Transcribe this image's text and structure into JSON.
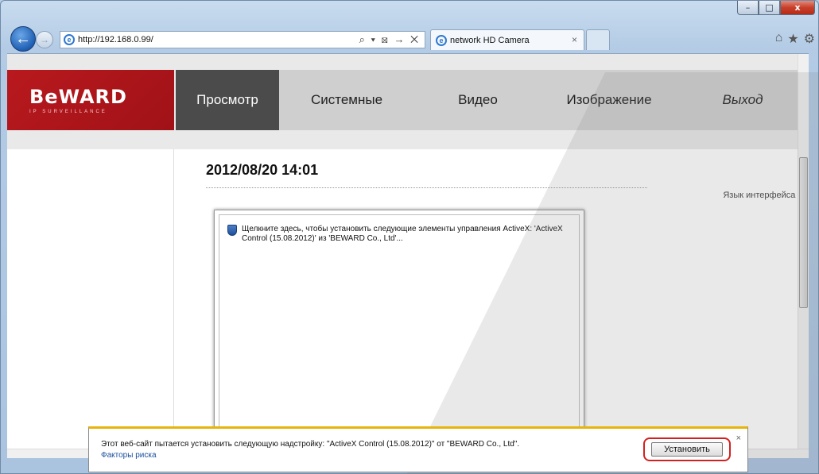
{
  "browser": {
    "url": "http://192.168.0.99/",
    "address_tools": "⌕ ▾ ⊠ → ✕",
    "tab_title": "network HD Camera",
    "tab_close": "×",
    "window_controls": {
      "minimize": "–",
      "maximize": "□",
      "close": "x"
    },
    "right_icons": {
      "home": "⌂",
      "favorites": "★",
      "settings": "⚙"
    }
  },
  "camera": {
    "logo_main": "BeWARD",
    "logo_sub": "IP SURVEILLANCE",
    "menu": [
      {
        "label": "Просмотр"
      },
      {
        "label": "Системные"
      },
      {
        "label": "Видео"
      },
      {
        "label": "Изображение"
      },
      {
        "label": "Выход"
      }
    ],
    "datetime": "2012/08/20 14:01",
    "lang_label": "Язык интерфейса",
    "lang_arrow": "▾",
    "activex_message": "Щелкните здесь, чтобы установить следующие элементы управления ActiveX: 'ActiveX Control (15.08.2012)' из 'BEWARD Co., Ltd'..."
  },
  "notification": {
    "text": "Этот веб-сайт пытается установить следующую надстройку: \"ActiveX Control (15.08.2012)\" от \"BEWARD Co., Ltd\".",
    "link": "Факторы риска",
    "install_label": "Установить",
    "close": "×"
  },
  "colors": {
    "brand_red": "#b8191e",
    "menu_active": "#4b4b4b",
    "notify_accent": "#e8b30a",
    "highlight_red": "#d32020"
  }
}
